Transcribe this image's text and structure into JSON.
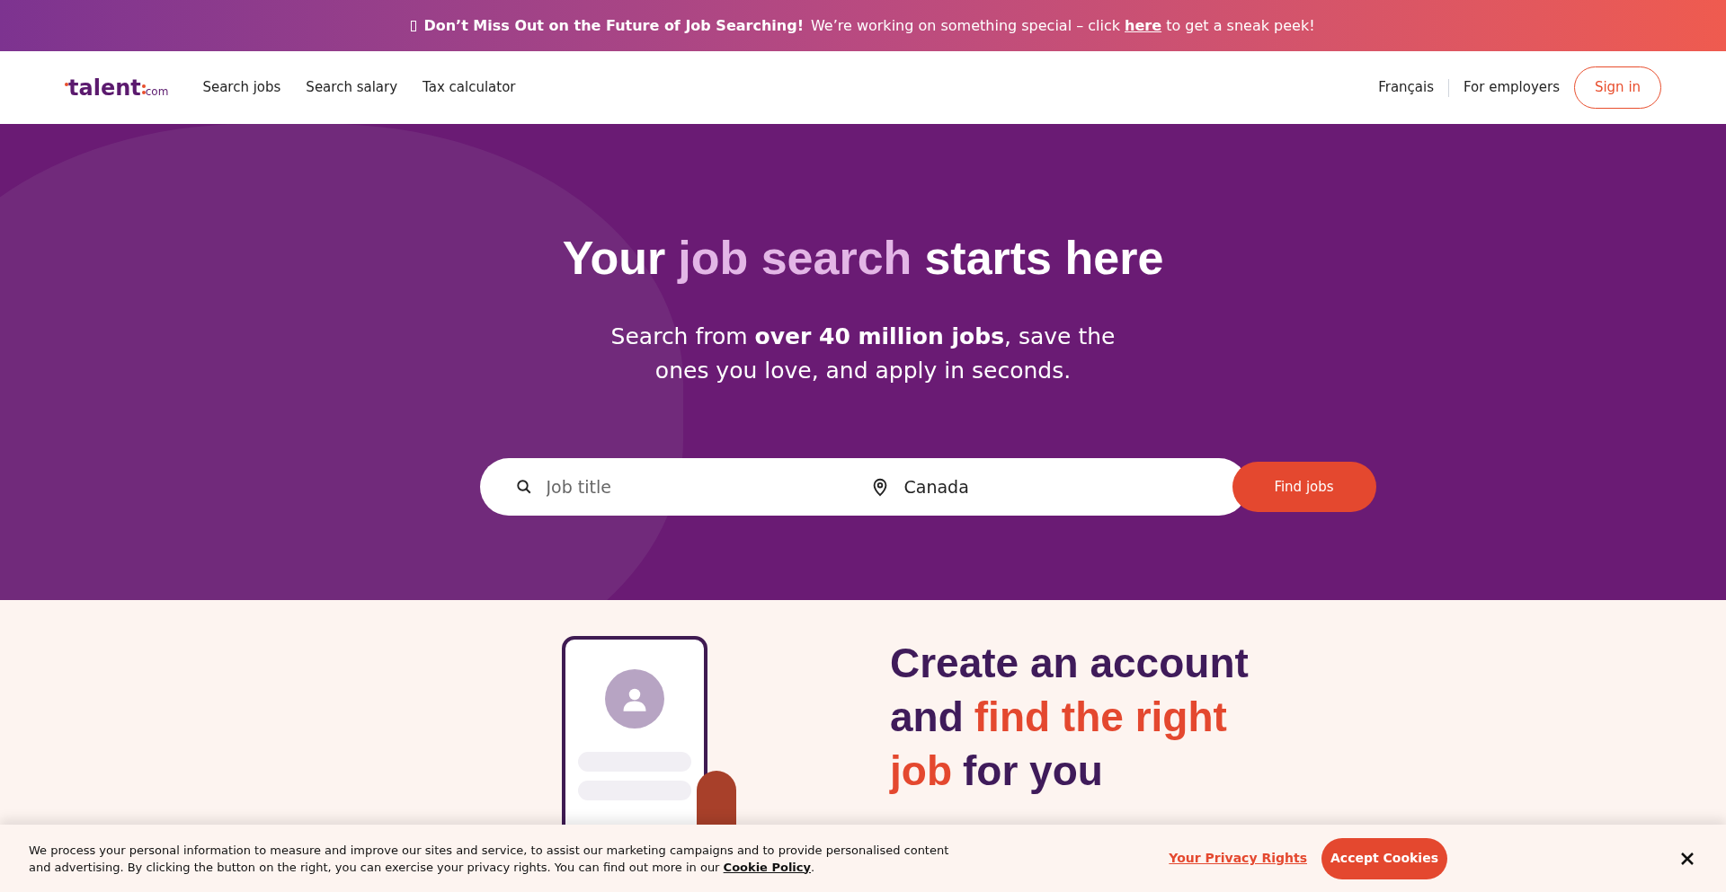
{
  "announcement": {
    "headline": "Don’t Miss Out on the Future of Job Searching!",
    "text_before": "We’re working on something special – click",
    "link": "here",
    "text_after": "to get a sneak peek!"
  },
  "nav": {
    "logo": "talent",
    "logo_suffix": "com",
    "links": [
      "Search jobs",
      "Search salary",
      "Tax calculator"
    ],
    "language": "Français",
    "employers": "For employers",
    "sign_in": "Sign in"
  },
  "hero": {
    "title": [
      {
        "text": "Your",
        "highlight": false
      },
      {
        "text": "job search",
        "highlight": true
      },
      {
        "text": "starts here",
        "highlight": false
      }
    ],
    "subtitle": "Search from **over 40 million jobs**, save the ones you love, and apply in seconds.",
    "job_field": {
      "placeholder": "Job title"
    },
    "location_field": {
      "value": "Canada"
    },
    "button": "Find jobs"
  },
  "promo": {
    "heading": [
      [
        {
          "text": "Create an account",
          "highlight": false
        }
      ],
      [
        {
          "text": "and",
          "highlight": false
        },
        {
          "text": "find the right",
          "highlight": true
        }
      ],
      [
        {
          "text": "job",
          "highlight": true
        },
        {
          "text": "for you",
          "highlight": false
        }
      ]
    ]
  },
  "cookie_banner": {
    "text": "We process your personal information to measure and improve our sites and service, to assist our marketing campaigns and to provide personalised content and advertising. By clicking the button on the right, you can exercise your privacy rights. You can find out more in our",
    "policy_link": "Cookie Policy",
    "policy_after": ".",
    "privacy_link": "Your Privacy Rights",
    "accept": "Accept Cookies"
  }
}
